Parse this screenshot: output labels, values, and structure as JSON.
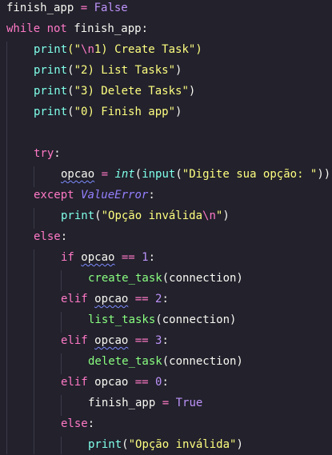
{
  "code": {
    "l1": {
      "var": "finish_app",
      "op": " = ",
      "val": "False"
    },
    "l2": {
      "kw": "while not",
      "rest": " finish_app:"
    },
    "l3": {
      "fn": "print",
      "open": "(\"",
      "esc": "\\n",
      "text": "1) Create Task",
      "close": "\")"
    },
    "l4": {
      "fn": "print",
      "open": "(",
      "str": "\"2) List Tasks\"",
      "close": ")"
    },
    "l5": {
      "fn": "print",
      "open": "(",
      "str": "\"3) Delete Tasks\"",
      "close": ")"
    },
    "l6": {
      "fn": "print",
      "open": "(",
      "str": "\"0) Finish app\"",
      "close": ")"
    },
    "l8": {
      "kw": "try",
      "rest": ":"
    },
    "l9": {
      "var": "opcao",
      "op": " = ",
      "type": "int",
      "p1": "(",
      "fn": "input",
      "p2": "(",
      "str": "\"Digite sua opção: \"",
      "p3": "))"
    },
    "l10": {
      "kw": "except",
      "space": " ",
      "cls": "ValueError",
      "rest": ":"
    },
    "l11": {
      "fn": "print",
      "open": "(",
      "str": "\"Opção inválida",
      "esc": "\\n",
      "strend": "\"",
      "close": ")"
    },
    "l12": {
      "kw": "else",
      "rest": ":"
    },
    "l13": {
      "kw": "if",
      "var": "opcao",
      "op": " == ",
      "num": "1",
      "rest": ":"
    },
    "l14": {
      "fn": "create_task",
      "args": "(connection)"
    },
    "l15": {
      "kw": "elif",
      "var": "opcao",
      "op": " == ",
      "num": "2",
      "rest": ":"
    },
    "l16": {
      "fn": "list_tasks",
      "args": "(connection)"
    },
    "l17": {
      "kw": "elif",
      "var": "opcao",
      "op": " == ",
      "num": "3",
      "rest": ":"
    },
    "l18": {
      "fn": "delete_task",
      "args": "(connection)"
    },
    "l19": {
      "kw": "elif",
      "var": "opcao",
      "op": " == ",
      "num": "0",
      "rest": ":"
    },
    "l20": {
      "var": "finish_app",
      "op": " = ",
      "val": "True"
    },
    "l21": {
      "kw": "else",
      "rest": ":"
    },
    "l22": {
      "fn": "print",
      "open": "(",
      "str": "\"Opção inválida\"",
      "close": ")"
    }
  }
}
